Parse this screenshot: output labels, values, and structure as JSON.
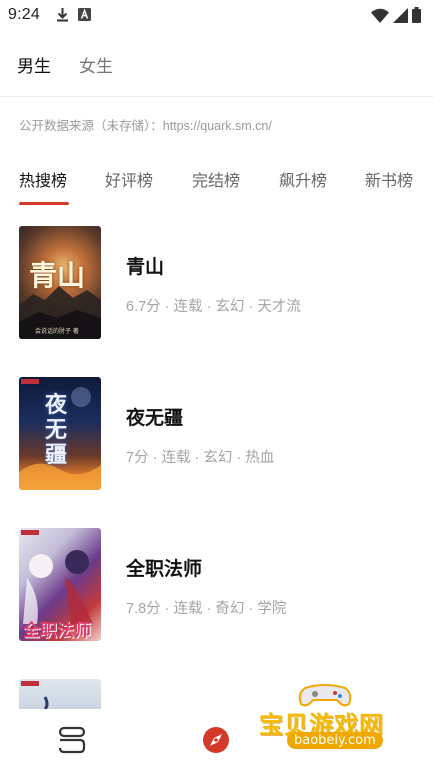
{
  "status_bar": {
    "time": "9:24",
    "left_icons": [
      "download-icon",
      "notification-a-icon"
    ],
    "right_icons": [
      "wifi-icon",
      "cellular-signal-icon",
      "battery-icon"
    ]
  },
  "gender_tabs": [
    {
      "label": "男生",
      "active": true
    },
    {
      "label": "女生",
      "active": false
    }
  ],
  "source_note": "公开数据来源（未存储）：https://quark.sm.cn/",
  "rank_tabs": [
    {
      "label": "热搜榜",
      "active": true
    },
    {
      "label": "好评榜",
      "active": false
    },
    {
      "label": "完结榜",
      "active": false
    },
    {
      "label": "飙升榜",
      "active": false
    },
    {
      "label": "新书榜",
      "active": false
    }
  ],
  "books": [
    {
      "title": "青山",
      "meta": "6.7分 · 连载 · 玄幻 · 天才流",
      "cover_text": "青山",
      "cover_subtext": "会说话的肘子 著"
    },
    {
      "title": "夜无疆",
      "meta": "7分 · 连载 · 玄幻 · 热血",
      "cover_text": "夜无疆",
      "cover_subtext": ""
    },
    {
      "title": "全职法师",
      "meta": "7.8分 · 连载 · 奇幻 · 学院",
      "cover_text": "全职法师",
      "cover_subtext": ""
    },
    {
      "title": "",
      "meta": "",
      "cover_text": "",
      "cover_subtext": ""
    }
  ],
  "bottom_nav": [
    {
      "icon": "bookshelf-icon"
    },
    {
      "icon": "discover-icon"
    }
  ],
  "watermark": {
    "text": "宝贝游戏网",
    "url": "baobeiy.com"
  },
  "colors": {
    "accent": "#d43a2a",
    "text_primary": "#111111",
    "text_secondary": "#a5a5a5",
    "watermark": "#f5b800"
  }
}
